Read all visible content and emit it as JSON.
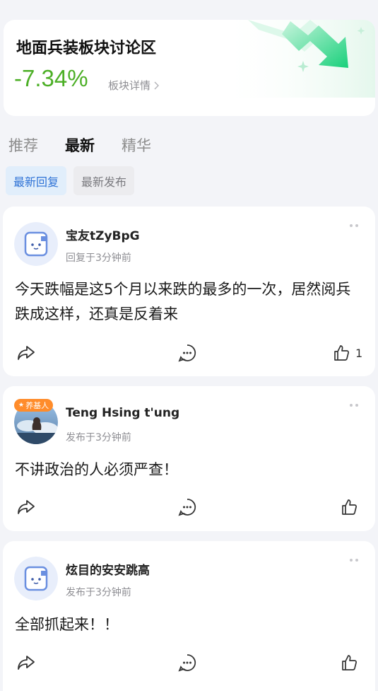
{
  "header": {
    "title": "地面兵装板块讨论区",
    "change": "-7.34%",
    "change_color": "#4caf26",
    "detail_label": "板块详情"
  },
  "tabs": [
    {
      "label": "推荐",
      "active": false
    },
    {
      "label": "最新",
      "active": true
    },
    {
      "label": "精华",
      "active": false
    }
  ],
  "subtabs": [
    {
      "label": "最新回复",
      "active": true
    },
    {
      "label": "最新发布",
      "active": false
    }
  ],
  "posts": [
    {
      "author": "宝友tZyBpG",
      "time": "回复于3分钟前",
      "content": "今天跌幅是这5个月以来跌的最多的一次，居然阅兵跌成这样，还真是反着来",
      "like_count": "1",
      "avatar": "default-avatar"
    },
    {
      "author": "Teng Hsing t'ung",
      "time": "发布于3分钟前",
      "content": "不讲政治的人必须严查！",
      "like_count": "",
      "avatar": "photo-avatar",
      "avatar_badge": "养基人"
    },
    {
      "author": "炫目的安安跳高",
      "time": "发布于3分钟前",
      "content": "全部抓起来！！",
      "like_count": "",
      "avatar": "default-avatar"
    }
  ]
}
